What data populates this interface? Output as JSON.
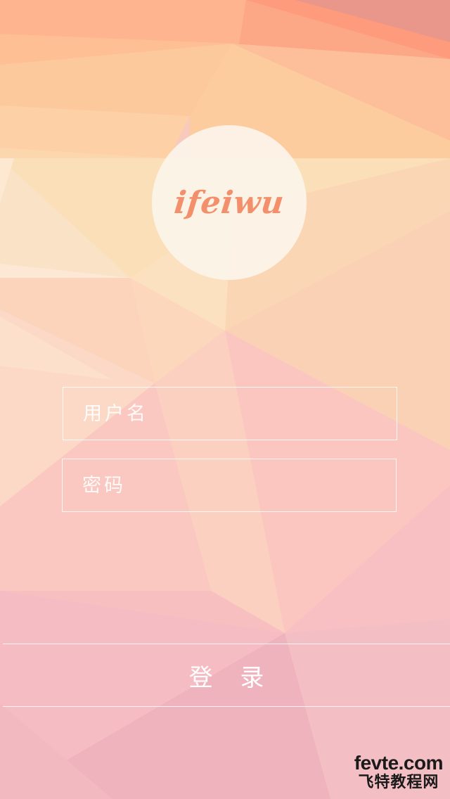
{
  "app": {
    "logo_text": "ifeiwu"
  },
  "login_form": {
    "username_placeholder": "用户名",
    "password_placeholder": "密码",
    "submit_label": "登 录"
  },
  "watermark": {
    "site": "fevte.com",
    "name": "飞特教程网"
  },
  "colors": {
    "logo_text": "#f3906b",
    "peach_top": "#fbcc9e",
    "pink_bottom": "#f5bcc3"
  }
}
